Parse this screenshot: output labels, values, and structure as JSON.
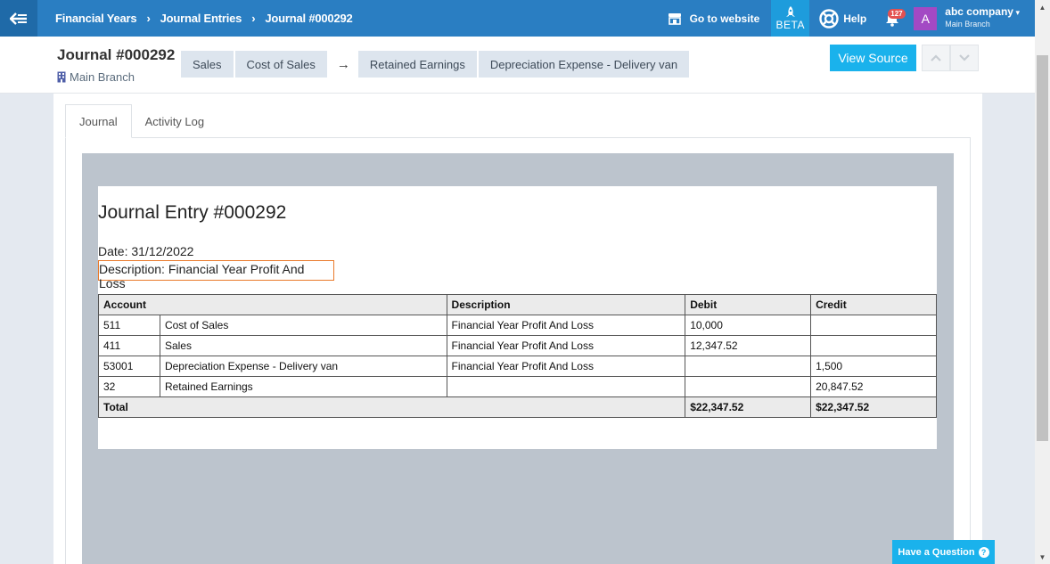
{
  "nav": {
    "breadcrumbs": [
      "Financial Years",
      "Journal Entries",
      "Journal #000292"
    ],
    "separator": "›",
    "goto_website": "Go to website",
    "beta": "BETA",
    "help": "Help",
    "notifications_count": "127",
    "avatar_letter": "A",
    "company": "abc company",
    "company_branch": "Main Branch"
  },
  "header": {
    "title": "Journal #000292",
    "branch": "Main Branch",
    "tags_left": [
      "Sales",
      "Cost of Sales"
    ],
    "arrow": "→",
    "tags_right": [
      "Retained Earnings",
      "Depreciation Expense - Delivery van"
    ],
    "view_source": "View Source"
  },
  "tabs": [
    "Journal",
    "Activity Log"
  ],
  "document": {
    "title": "Journal Entry #000292",
    "date_label": "Date:",
    "date": "31/12/2022",
    "description_label": "Description:",
    "description": "Financial Year Profit And Loss",
    "columns": [
      "Account",
      "Description",
      "Debit",
      "Credit"
    ],
    "rows": [
      {
        "code": "511",
        "account": "Cost of Sales",
        "description": "Financial Year Profit And Loss",
        "debit": "10,000",
        "credit": ""
      },
      {
        "code": "411",
        "account": "Sales",
        "description": "Financial Year Profit And Loss",
        "debit": "12,347.52",
        "credit": ""
      },
      {
        "code": "53001",
        "account": "Depreciation Expense - Delivery van",
        "description": "Financial Year Profit And Loss",
        "debit": "",
        "credit": "1,500"
      },
      {
        "code": "32",
        "account": "Retained Earnings",
        "description": "",
        "debit": "",
        "credit": "20,847.52"
      }
    ],
    "total_label": "Total",
    "total_debit": "$22,347.52",
    "total_credit": "$22,347.52"
  },
  "have_question": "Have a Question",
  "colors": {
    "topbar": "#2a7ec2",
    "accent": "#1ab2ec",
    "avatar": "#a349c4",
    "badge": "#e35151",
    "highlight_border": "#e97a2b"
  }
}
